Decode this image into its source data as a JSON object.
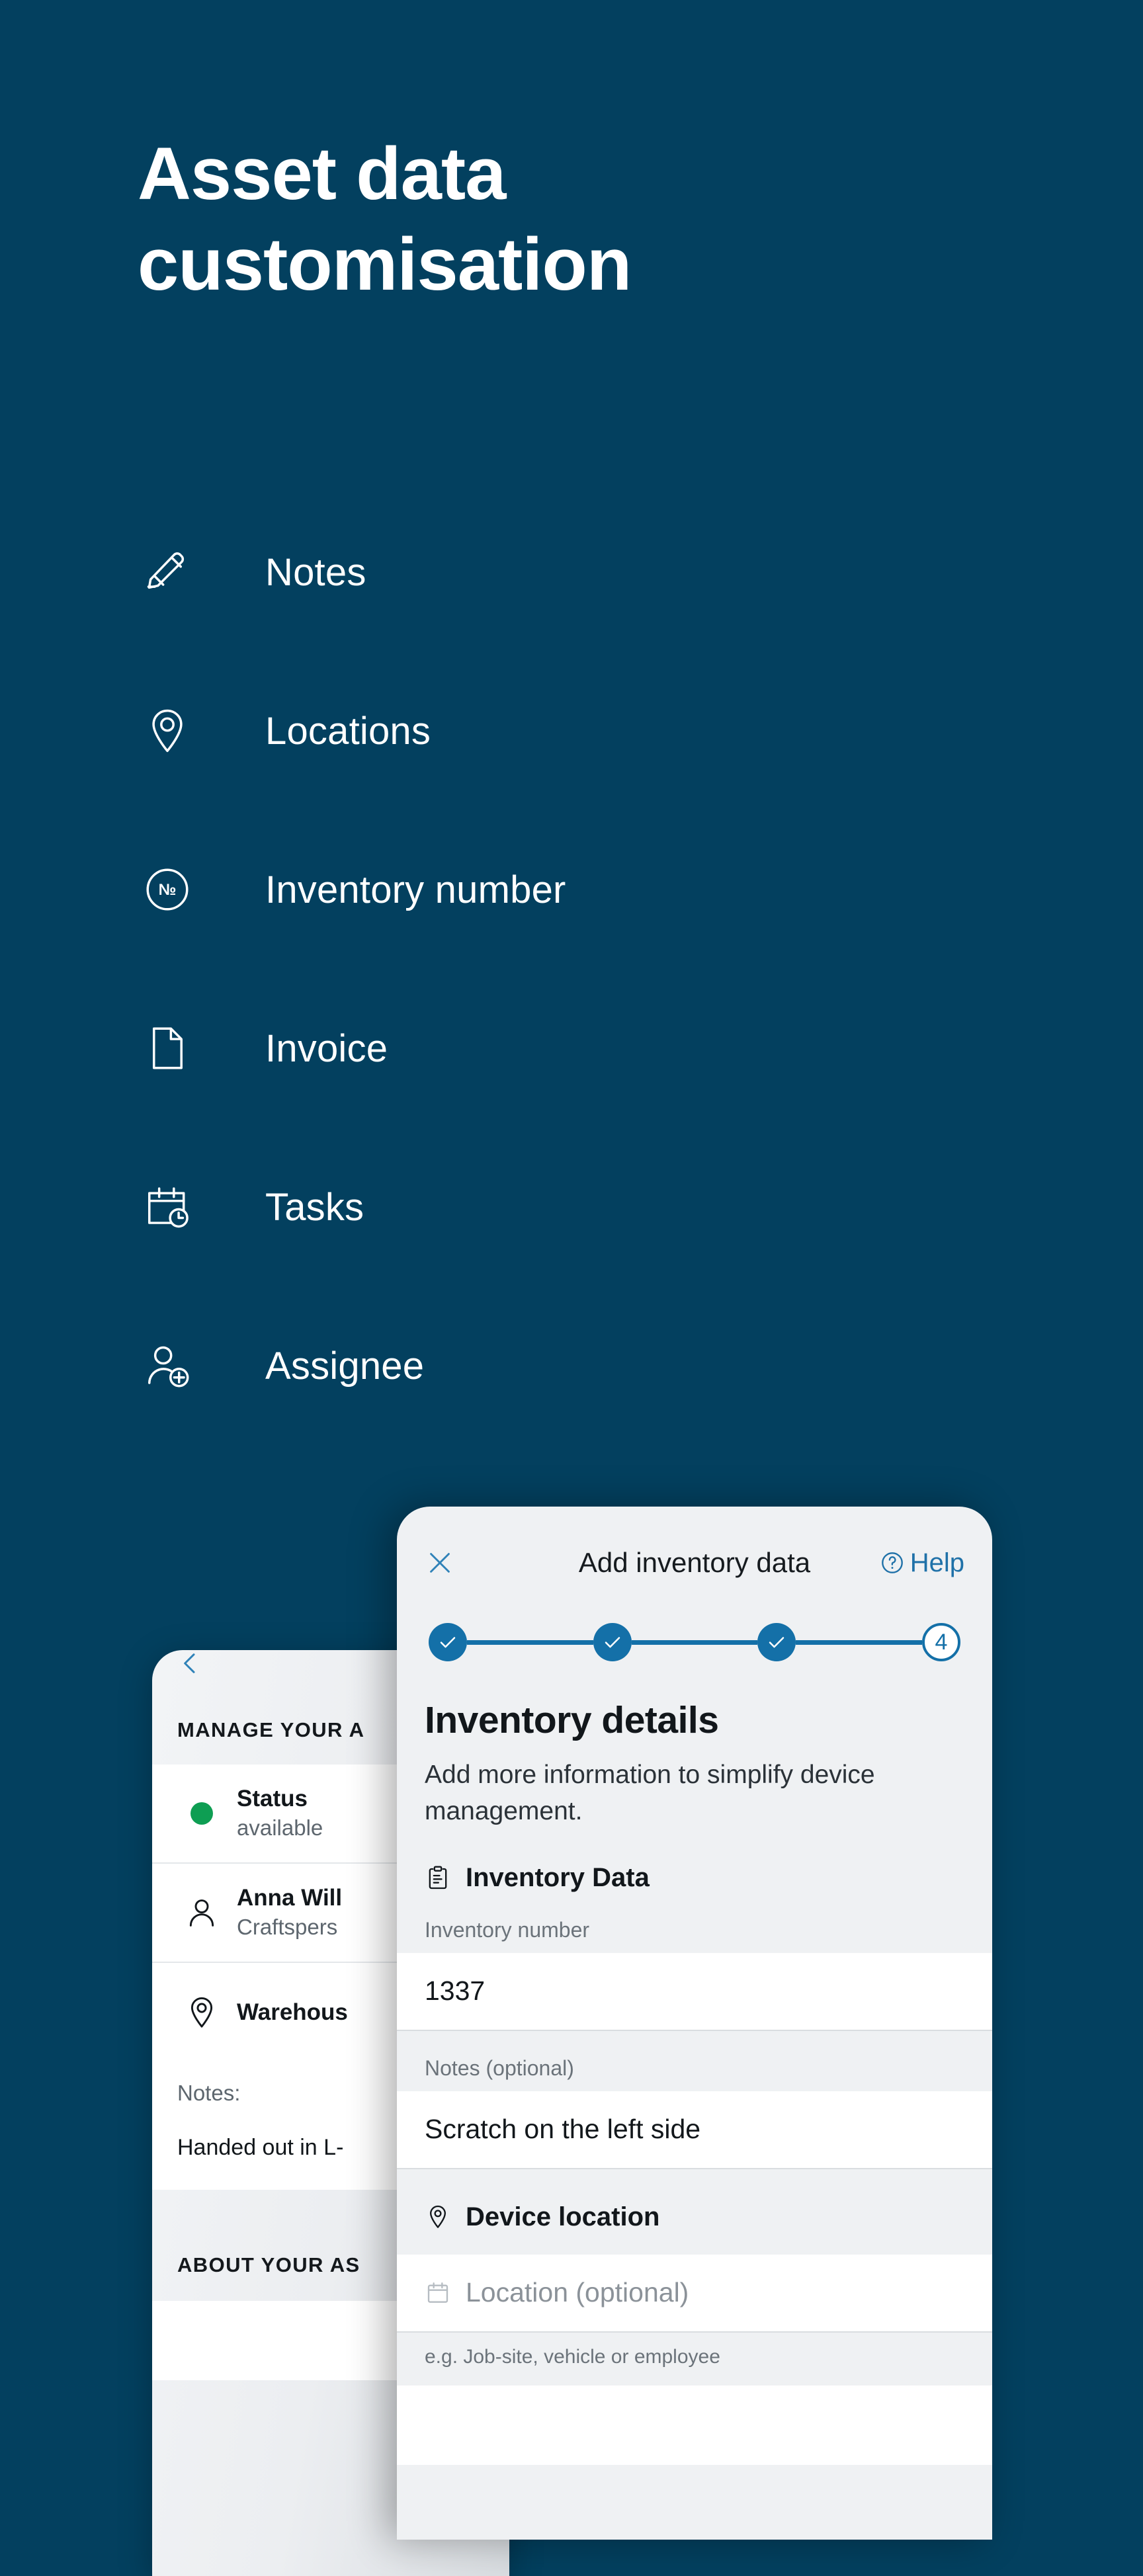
{
  "hero": {
    "title": "Asset data\ncustomisation"
  },
  "features": [
    {
      "icon": "pencil-icon",
      "label": "Notes"
    },
    {
      "icon": "map-pin-icon",
      "label": "Locations"
    },
    {
      "icon": "numero-icon",
      "label": "Inventory number"
    },
    {
      "icon": "document-icon",
      "label": "Invoice"
    },
    {
      "icon": "calendar-clock-icon",
      "label": "Tasks"
    },
    {
      "icon": "person-add-icon",
      "label": "Assignee"
    }
  ],
  "phone_back": {
    "back_icon": "chevron-left-icon",
    "section_title": "MANAGE YOUR A",
    "rows": [
      {
        "icon": "status-dot-green",
        "title": "Status",
        "sub": "available"
      },
      {
        "icon": "person-icon",
        "title": "Anna Will",
        "sub": "Craftspers"
      },
      {
        "icon": "map-pin-icon",
        "title": "Warehous",
        "sub": ""
      }
    ],
    "notes_label": "Notes:",
    "notes_value": "Handed out in L-",
    "section_title_2": "ABOUT YOUR AS"
  },
  "phone_front": {
    "close_icon": "close-icon",
    "title": "Add inventory data",
    "help_icon": "question-circle-icon",
    "help_label": "Help",
    "stepper": {
      "steps": [
        {
          "state": "done",
          "label": ""
        },
        {
          "state": "done",
          "label": ""
        },
        {
          "state": "done",
          "label": ""
        },
        {
          "state": "current",
          "label": "4"
        }
      ]
    },
    "heading": "Inventory details",
    "subheading": "Add more information to simplify device management.",
    "group_inventory": {
      "icon": "clipboard-icon",
      "title": "Inventory Data",
      "fields": [
        {
          "label": "Inventory number",
          "value": "1337",
          "placeholder": ""
        },
        {
          "label": "Notes (optional)",
          "value": "Scratch on the left side",
          "placeholder": ""
        }
      ]
    },
    "group_location": {
      "icon": "map-pin-icon",
      "title": "Device location",
      "field": {
        "icon": "calendar-icon",
        "placeholder": "Location (optional)",
        "hint": "e.g. Job-site, vehicle or employee"
      }
    }
  },
  "colors": {
    "background": "#03405f",
    "accent_blue": "#1470a8",
    "link_blue": "#1f71a8",
    "status_green": "#0e9e53",
    "card_bg": "#eff1f3",
    "white": "#ffffff"
  }
}
